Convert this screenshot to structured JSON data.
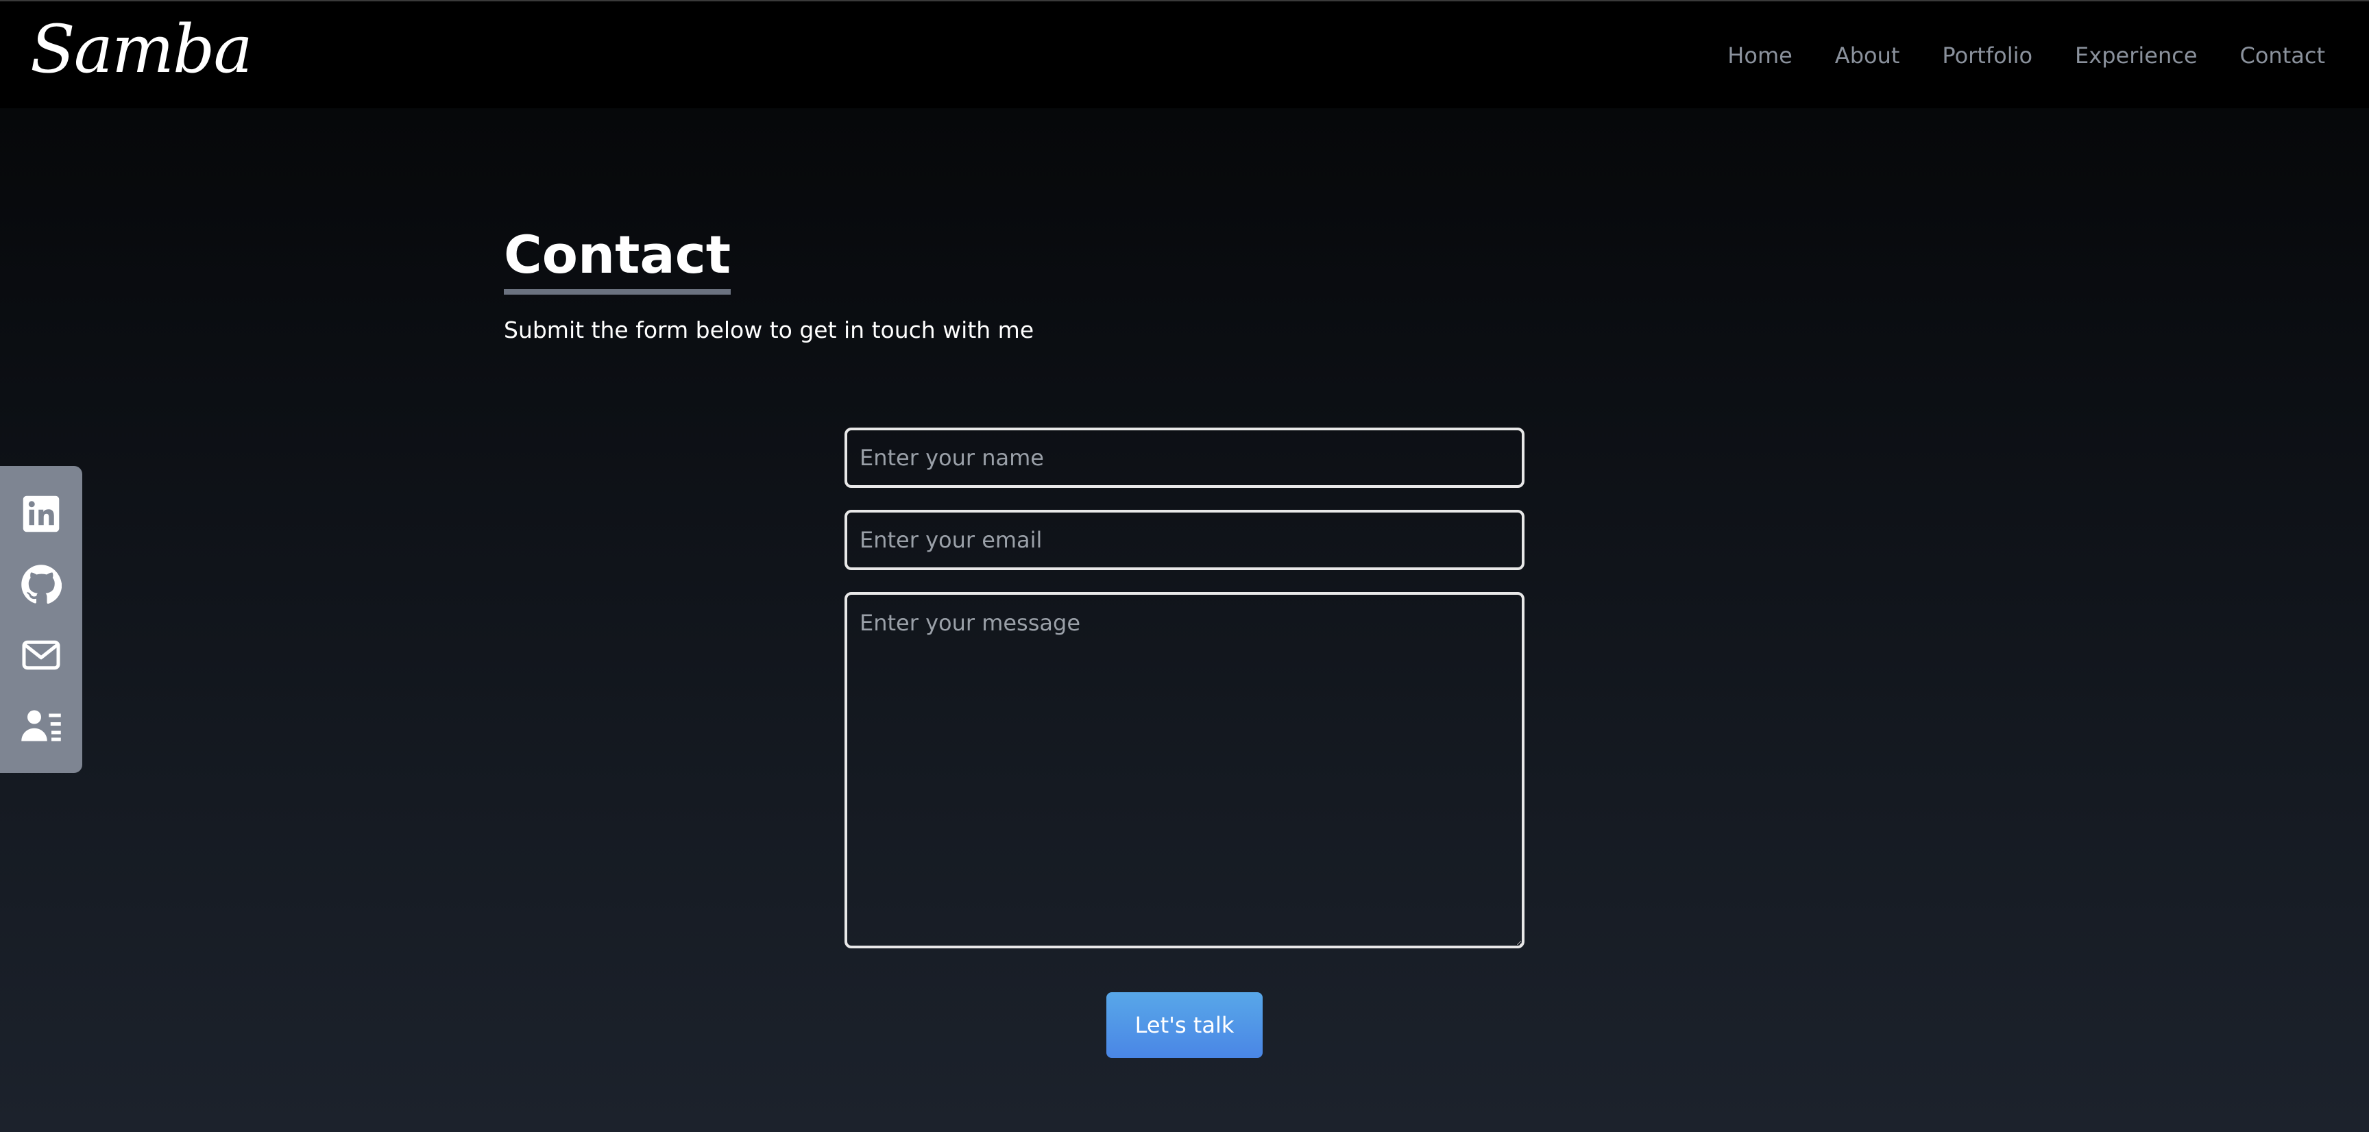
{
  "brand": {
    "logo": "Samba"
  },
  "nav": {
    "items": [
      {
        "label": "Home"
      },
      {
        "label": "About"
      },
      {
        "label": "Portfolio"
      },
      {
        "label": "Experience"
      },
      {
        "label": "Contact"
      }
    ]
  },
  "social": {
    "items": [
      {
        "icon": "linkedin-icon"
      },
      {
        "icon": "github-icon"
      },
      {
        "icon": "mail-icon"
      },
      {
        "icon": "resume-icon"
      }
    ]
  },
  "contact": {
    "title": "Contact",
    "subtitle": "Submit the form below to get in touch with me",
    "name_placeholder": "Enter your name",
    "email_placeholder": "Enter your email",
    "message_placeholder": "Enter your message",
    "submit_label": "Let's talk"
  },
  "colors": {
    "nav_text": "#8a919c",
    "sidebar_bg": "#7e8592",
    "button_bg": "#4a86e6",
    "title_underline": "#6b7280"
  }
}
